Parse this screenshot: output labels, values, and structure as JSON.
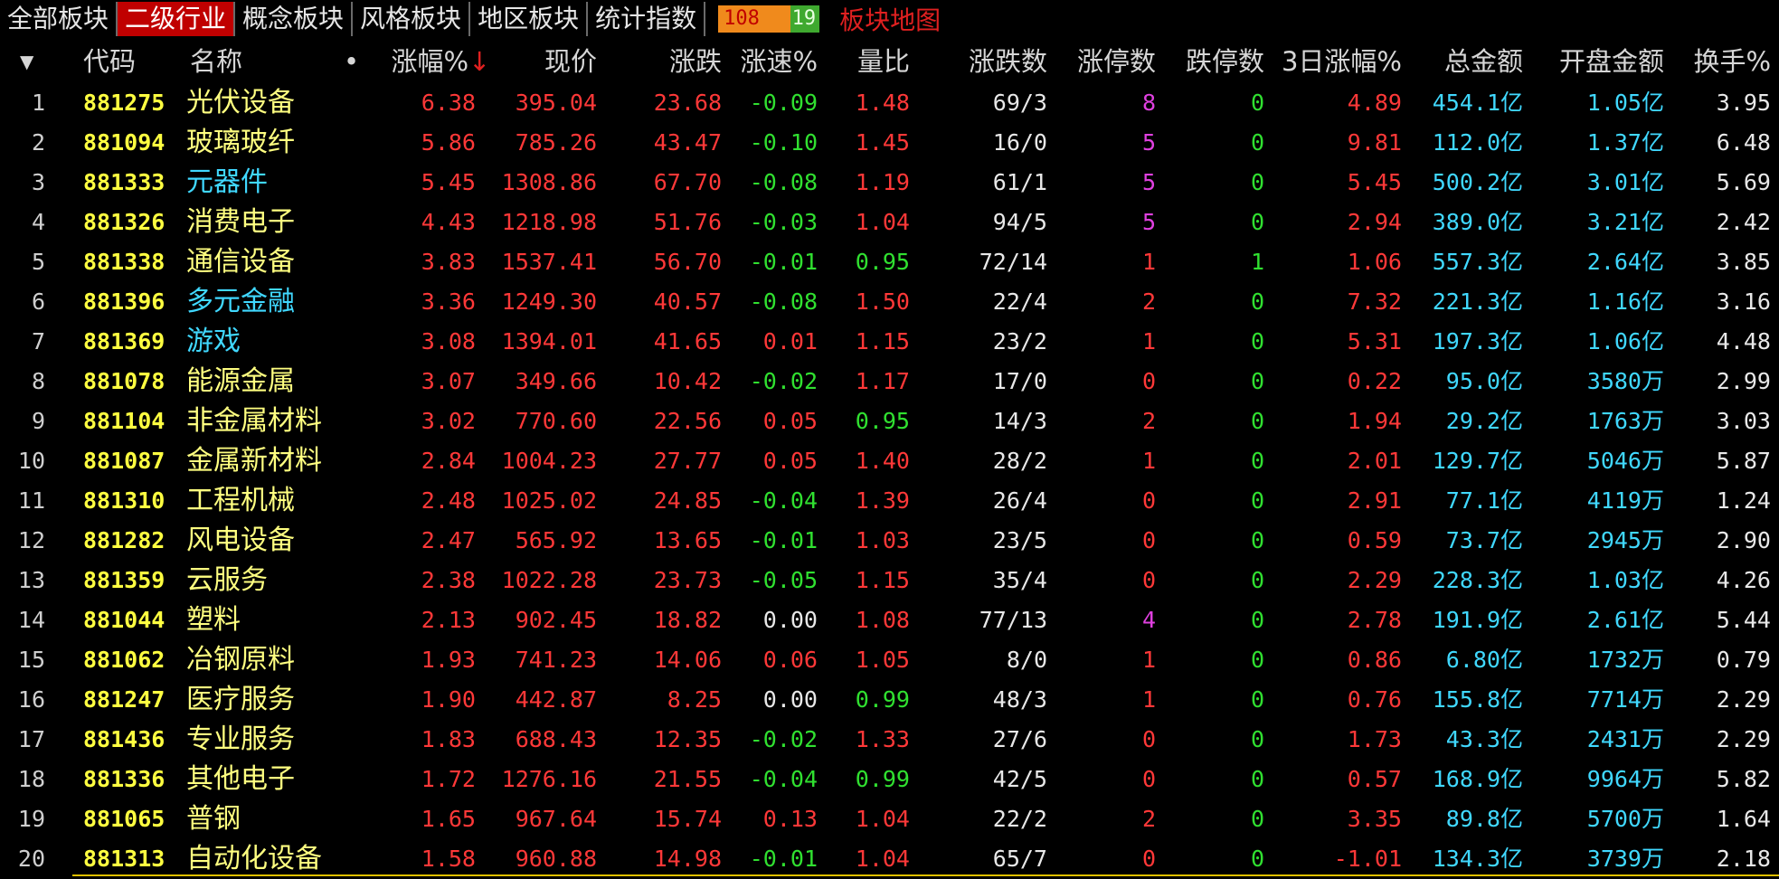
{
  "tabs": [
    "全部板块",
    "二级行业",
    "概念板块",
    "风格板块",
    "地区板块",
    "统计指数"
  ],
  "active_tab": "二级行业",
  "counter": {
    "up": "108",
    "down": "19"
  },
  "map_link": "板块地图",
  "header": {
    "sort_icon": "▼",
    "code": "代码",
    "name": "名称",
    "dot": "•",
    "pct": "涨幅%",
    "sort_arrow": "↓",
    "price": "现价",
    "change": "涨跌",
    "speed": "涨速%",
    "vol_ratio": "量比",
    "up_down": "涨跌数",
    "limit_up": "涨停数",
    "limit_down": "跌停数",
    "pct3d": "3日涨幅%",
    "amount": "总金额",
    "open_amount": "开盘金额",
    "turnover": "换手%"
  },
  "colors": {
    "red": "#ff3838",
    "green": "#30e030",
    "yellow": "#ffff40",
    "cyan": "#40d8ff",
    "magenta": "#e040e0",
    "tab_active": "#c00000"
  },
  "rows": [
    {
      "idx": "1",
      "code": "881275",
      "name": "光伏设备",
      "name_color": "y",
      "pct": "6.38",
      "price": "395.04",
      "change": "23.68",
      "speed": "-0.09",
      "vol_ratio": "1.48",
      "up_down": "69/3",
      "limit_up": "8",
      "limit_down": "0",
      "pct3d": "4.89",
      "amount": "454.1亿",
      "open_amount": "1.05亿",
      "turnover": "3.95"
    },
    {
      "idx": "2",
      "code": "881094",
      "name": "玻璃玻纤",
      "name_color": "y",
      "pct": "5.86",
      "price": "785.26",
      "change": "43.47",
      "speed": "-0.10",
      "vol_ratio": "1.45",
      "up_down": "16/0",
      "limit_up": "5",
      "limit_down": "0",
      "pct3d": "9.81",
      "amount": "112.0亿",
      "open_amount": "1.37亿",
      "turnover": "6.48"
    },
    {
      "idx": "3",
      "code": "881333",
      "name": "元器件",
      "name_color": "c",
      "pct": "5.45",
      "price": "1308.86",
      "change": "67.70",
      "speed": "-0.08",
      "vol_ratio": "1.19",
      "up_down": "61/1",
      "limit_up": "5",
      "limit_down": "0",
      "pct3d": "5.45",
      "amount": "500.2亿",
      "open_amount": "3.01亿",
      "turnover": "5.69"
    },
    {
      "idx": "4",
      "code": "881326",
      "name": "消费电子",
      "name_color": "y",
      "pct": "4.43",
      "price": "1218.98",
      "change": "51.76",
      "speed": "-0.03",
      "vol_ratio": "1.04",
      "up_down": "94/5",
      "limit_up": "5",
      "limit_down": "0",
      "pct3d": "2.94",
      "amount": "389.0亿",
      "open_amount": "3.21亿",
      "turnover": "2.42"
    },
    {
      "idx": "5",
      "code": "881338",
      "name": "通信设备",
      "name_color": "y",
      "pct": "3.83",
      "price": "1537.41",
      "change": "56.70",
      "speed": "-0.01",
      "vol_ratio": "0.95",
      "up_down": "72/14",
      "limit_up": "1",
      "limit_down": "1",
      "pct3d": "1.06",
      "amount": "557.3亿",
      "open_amount": "2.64亿",
      "turnover": "3.85"
    },
    {
      "idx": "6",
      "code": "881396",
      "name": "多元金融",
      "name_color": "c",
      "pct": "3.36",
      "price": "1249.30",
      "change": "40.57",
      "speed": "-0.08",
      "vol_ratio": "1.50",
      "up_down": "22/4",
      "limit_up": "2",
      "limit_down": "0",
      "pct3d": "7.32",
      "amount": "221.3亿",
      "open_amount": "1.16亿",
      "turnover": "3.16"
    },
    {
      "idx": "7",
      "code": "881369",
      "name": "游戏",
      "name_color": "c",
      "pct": "3.08",
      "price": "1394.01",
      "change": "41.65",
      "speed": "0.01",
      "vol_ratio": "1.15",
      "up_down": "23/2",
      "limit_up": "1",
      "limit_down": "0",
      "pct3d": "5.31",
      "amount": "197.3亿",
      "open_amount": "1.06亿",
      "turnover": "4.48"
    },
    {
      "idx": "8",
      "code": "881078",
      "name": "能源金属",
      "name_color": "y",
      "pct": "3.07",
      "price": "349.66",
      "change": "10.42",
      "speed": "-0.02",
      "vol_ratio": "1.17",
      "up_down": "17/0",
      "limit_up": "0",
      "limit_down": "0",
      "pct3d": "0.22",
      "amount": "95.0亿",
      "open_amount": "3580万",
      "turnover": "2.99"
    },
    {
      "idx": "9",
      "code": "881104",
      "name": "非金属材料",
      "name_color": "y",
      "pct": "3.02",
      "price": "770.60",
      "change": "22.56",
      "speed": "0.05",
      "vol_ratio": "0.95",
      "up_down": "14/3",
      "limit_up": "2",
      "limit_down": "0",
      "pct3d": "1.94",
      "amount": "29.2亿",
      "open_amount": "1763万",
      "turnover": "3.03"
    },
    {
      "idx": "10",
      "code": "881087",
      "name": "金属新材料",
      "name_color": "y",
      "pct": "2.84",
      "price": "1004.23",
      "change": "27.77",
      "speed": "0.05",
      "vol_ratio": "1.40",
      "up_down": "28/2",
      "limit_up": "1",
      "limit_down": "0",
      "pct3d": "2.01",
      "amount": "129.7亿",
      "open_amount": "5046万",
      "turnover": "5.87"
    },
    {
      "idx": "11",
      "code": "881310",
      "name": "工程机械",
      "name_color": "y",
      "pct": "2.48",
      "price": "1025.02",
      "change": "24.85",
      "speed": "-0.04",
      "vol_ratio": "1.39",
      "up_down": "26/4",
      "limit_up": "0",
      "limit_down": "0",
      "pct3d": "2.91",
      "amount": "77.1亿",
      "open_amount": "4119万",
      "turnover": "1.24"
    },
    {
      "idx": "12",
      "code": "881282",
      "name": "风电设备",
      "name_color": "y",
      "pct": "2.47",
      "price": "565.92",
      "change": "13.65",
      "speed": "-0.01",
      "vol_ratio": "1.03",
      "up_down": "23/5",
      "limit_up": "0",
      "limit_down": "0",
      "pct3d": "0.59",
      "amount": "73.7亿",
      "open_amount": "2945万",
      "turnover": "2.90"
    },
    {
      "idx": "13",
      "code": "881359",
      "name": "云服务",
      "name_color": "y",
      "pct": "2.38",
      "price": "1022.28",
      "change": "23.73",
      "speed": "-0.05",
      "vol_ratio": "1.15",
      "up_down": "35/4",
      "limit_up": "0",
      "limit_down": "0",
      "pct3d": "2.29",
      "amount": "228.3亿",
      "open_amount": "1.03亿",
      "turnover": "4.26"
    },
    {
      "idx": "14",
      "code": "881044",
      "name": "塑料",
      "name_color": "y",
      "pct": "2.13",
      "price": "902.45",
      "change": "18.82",
      "speed": "0.00",
      "vol_ratio": "1.08",
      "up_down": "77/13",
      "limit_up": "4",
      "limit_down": "0",
      "pct3d": "2.78",
      "amount": "191.9亿",
      "open_amount": "2.61亿",
      "turnover": "5.44"
    },
    {
      "idx": "15",
      "code": "881062",
      "name": "冶钢原料",
      "name_color": "y",
      "pct": "1.93",
      "price": "741.23",
      "change": "14.06",
      "speed": "0.06",
      "vol_ratio": "1.05",
      "up_down": "8/0",
      "limit_up": "1",
      "limit_down": "0",
      "pct3d": "0.86",
      "amount": "6.80亿",
      "open_amount": "1732万",
      "turnover": "0.79"
    },
    {
      "idx": "16",
      "code": "881247",
      "name": "医疗服务",
      "name_color": "y",
      "pct": "1.90",
      "price": "442.87",
      "change": "8.25",
      "speed": "0.00",
      "vol_ratio": "0.99",
      "up_down": "48/3",
      "limit_up": "1",
      "limit_down": "0",
      "pct3d": "0.76",
      "amount": "155.8亿",
      "open_amount": "7714万",
      "turnover": "2.29"
    },
    {
      "idx": "17",
      "code": "881436",
      "name": "专业服务",
      "name_color": "y",
      "pct": "1.83",
      "price": "688.43",
      "change": "12.35",
      "speed": "-0.02",
      "vol_ratio": "1.33",
      "up_down": "27/6",
      "limit_up": "0",
      "limit_down": "0",
      "pct3d": "1.73",
      "amount": "43.3亿",
      "open_amount": "2431万",
      "turnover": "2.29"
    },
    {
      "idx": "18",
      "code": "881336",
      "name": "其他电子",
      "name_color": "y",
      "pct": "1.72",
      "price": "1276.16",
      "change": "21.55",
      "speed": "-0.04",
      "vol_ratio": "0.99",
      "up_down": "42/5",
      "limit_up": "0",
      "limit_down": "0",
      "pct3d": "0.57",
      "amount": "168.9亿",
      "open_amount": "9964万",
      "turnover": "5.82"
    },
    {
      "idx": "19",
      "code": "881065",
      "name": "普钢",
      "name_color": "y",
      "pct": "1.65",
      "price": "967.64",
      "change": "15.74",
      "speed": "0.13",
      "vol_ratio": "1.04",
      "up_down": "22/2",
      "limit_up": "2",
      "limit_down": "0",
      "pct3d": "3.35",
      "amount": "89.8亿",
      "open_amount": "5700万",
      "turnover": "1.64"
    },
    {
      "idx": "20",
      "code": "881313",
      "name": "自动化设备",
      "name_color": "y",
      "pct": "1.58",
      "price": "960.88",
      "change": "14.98",
      "speed": "-0.01",
      "vol_ratio": "1.04",
      "up_down": "65/7",
      "limit_up": "0",
      "limit_down": "0",
      "pct3d": "-1.01",
      "amount": "134.3亿",
      "open_amount": "3739万",
      "turnover": "2.18"
    }
  ]
}
